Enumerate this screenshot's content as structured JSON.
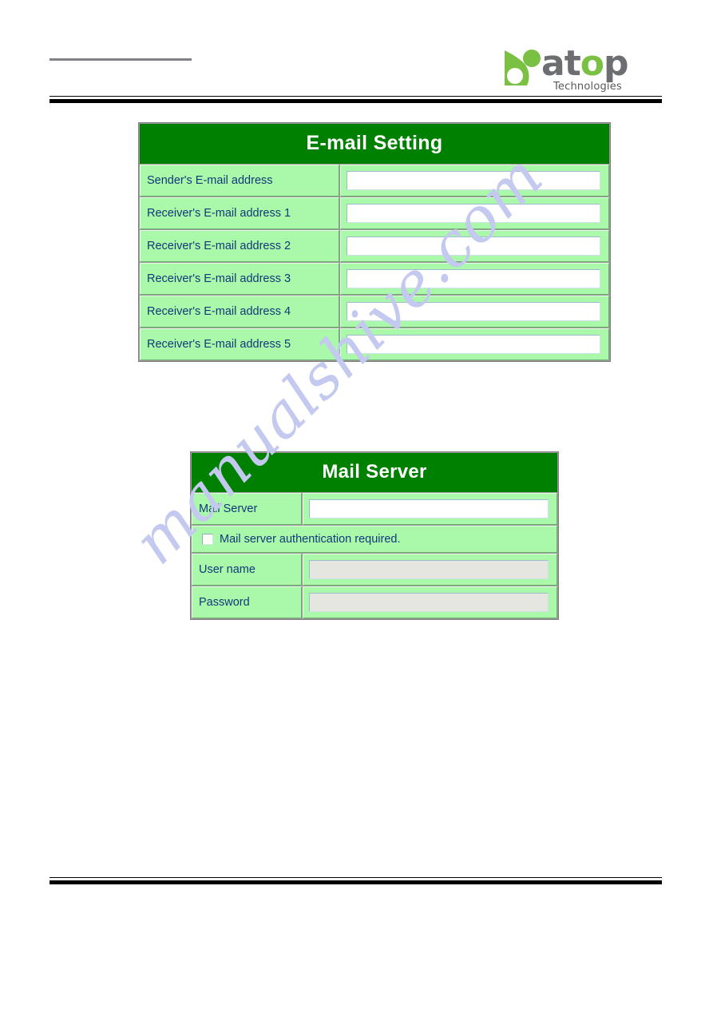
{
  "brand": {
    "wordmark_pre": "at",
    "wordmark_accent": "o",
    "wordmark_post": "p",
    "tagline": "Technologies",
    "mark_name": "atop-leaf-mark",
    "colors": {
      "gray": "#6d6e71",
      "green": "#7ac143"
    }
  },
  "watermark": {
    "text": "manualshive.com",
    "color": "#c3c9ef"
  },
  "email_setting": {
    "title": "E-mail Setting",
    "title_bg": "#008000",
    "row_bg": "#aaf8aa",
    "label_color": "#11397a",
    "rows": [
      {
        "label": "Sender's E-mail address",
        "value": "",
        "placeholder": "",
        "disabled": false
      },
      {
        "label": "Receiver's E-mail address 1",
        "value": "",
        "placeholder": "",
        "disabled": false
      },
      {
        "label": "Receiver's E-mail address 2",
        "value": "",
        "placeholder": "",
        "disabled": false
      },
      {
        "label": "Receiver's E-mail address 3",
        "value": "",
        "placeholder": "",
        "disabled": false
      },
      {
        "label": "Receiver's E-mail address 4",
        "value": "",
        "placeholder": "",
        "disabled": false
      },
      {
        "label": "Receiver's E-mail address 5",
        "value": "",
        "placeholder": "",
        "disabled": false
      }
    ]
  },
  "mail_server": {
    "title": "Mail Server",
    "title_bg": "#008000",
    "row_bg": "#aaf8aa",
    "label_color": "#11397a",
    "server_row": {
      "label": "Mail Server",
      "value": "",
      "disabled": false
    },
    "auth_row": {
      "label": "Mail server authentication required.",
      "checked": false
    },
    "username_row": {
      "label": "User name",
      "value": "",
      "disabled": true
    },
    "password_row": {
      "label": "Password",
      "value": "",
      "disabled": true
    }
  }
}
